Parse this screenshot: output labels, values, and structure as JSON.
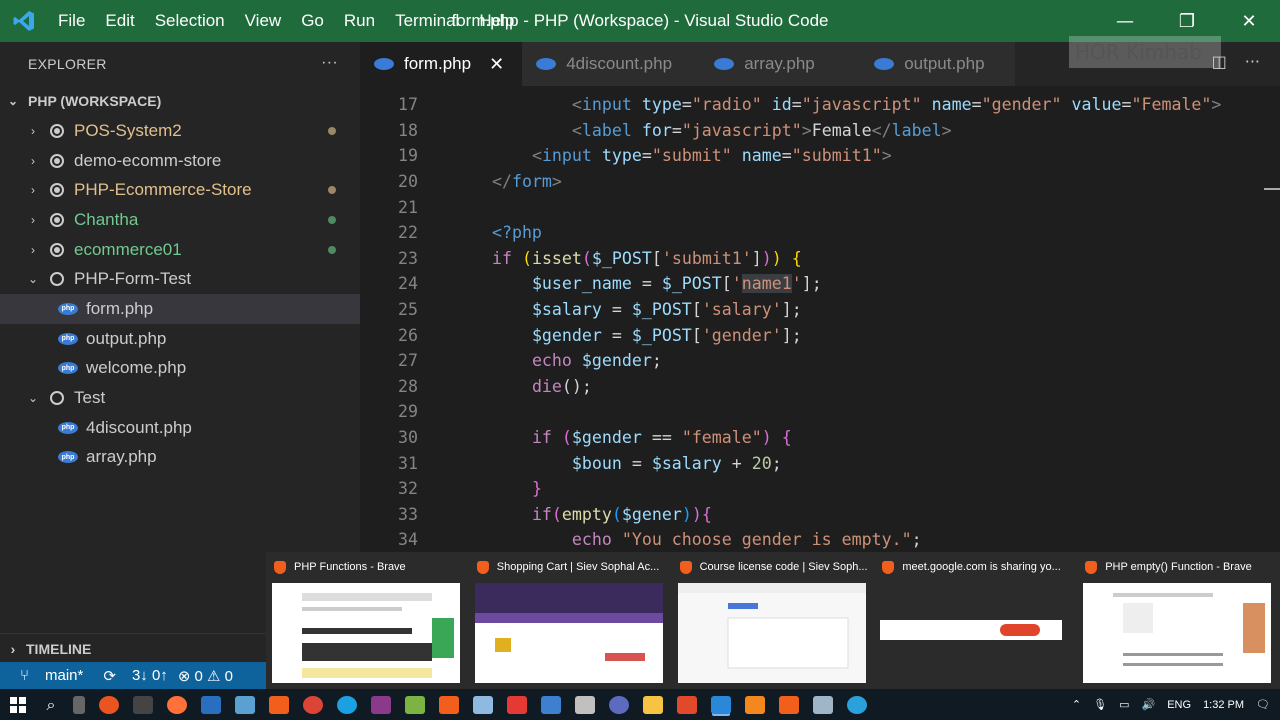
{
  "window": {
    "title": "form.php - PHP (Workspace) - Visual Studio Code",
    "menu": [
      "File",
      "Edit",
      "Selection",
      "View",
      "Go",
      "Run",
      "Terminal",
      "Help"
    ]
  },
  "sidebar": {
    "header": "EXPLORER",
    "workspace": "PHP (WORKSPACE)",
    "items": [
      {
        "label": "POS-System2",
        "kind": "folder",
        "color": "#e2c08d",
        "dot": "#9b8866"
      },
      {
        "label": "demo-ecomm-store",
        "kind": "folder",
        "color": "#cccccc"
      },
      {
        "label": "PHP-Ecommerce-Store",
        "kind": "folder",
        "color": "#e2c08d",
        "dot": "#9b8866"
      },
      {
        "label": "Chantha",
        "kind": "folder",
        "color": "#73c991",
        "dot": "#4e8c5e"
      },
      {
        "label": "ecommerce01",
        "kind": "folder",
        "color": "#73c991",
        "dot": "#4e8c5e"
      },
      {
        "label": "PHP-Form-Test",
        "kind": "folder-open",
        "color": "#cccccc"
      },
      {
        "label": "form.php",
        "kind": "file",
        "selected": true
      },
      {
        "label": "output.php",
        "kind": "file"
      },
      {
        "label": "welcome.php",
        "kind": "file"
      },
      {
        "label": "Test",
        "kind": "folder-open",
        "color": "#cccccc"
      },
      {
        "label": "4discount.php",
        "kind": "file"
      },
      {
        "label": "array.php",
        "kind": "file"
      }
    ],
    "timeline": "TIMELINE"
  },
  "tabs": [
    {
      "label": "form.php",
      "active": true
    },
    {
      "label": "4discount.php"
    },
    {
      "label": "array.php"
    },
    {
      "label": "output.php"
    }
  ],
  "watermark": "HOR Kimhab",
  "code": {
    "line_numbers": [
      "17",
      "18",
      "19",
      "20",
      "21",
      "22",
      "23",
      "24",
      "25",
      "26",
      "27",
      "28",
      "29",
      "30",
      "31",
      "32",
      "33",
      "34"
    ]
  },
  "thumbnails": [
    {
      "title": "PHP Functions - Brave"
    },
    {
      "title": "Shopping Cart | Siev Sophal Ac..."
    },
    {
      "title": "Course license code | Siev Soph..."
    },
    {
      "title": "meet.google.com is sharing yo..."
    },
    {
      "title": "PHP empty() Function - Brave"
    }
  ],
  "statusbar": {
    "branch": "main*",
    "sync": "3↓ 0↑",
    "problems": "⊗ 0 ⚠ 0"
  },
  "taskbar": {
    "lang": "ENG",
    "time": "1:32 PM"
  },
  "colors": {
    "titlebar": "#1f6b3c",
    "statusbar": "#0e639c",
    "editor_bg": "#1e1e1e"
  }
}
